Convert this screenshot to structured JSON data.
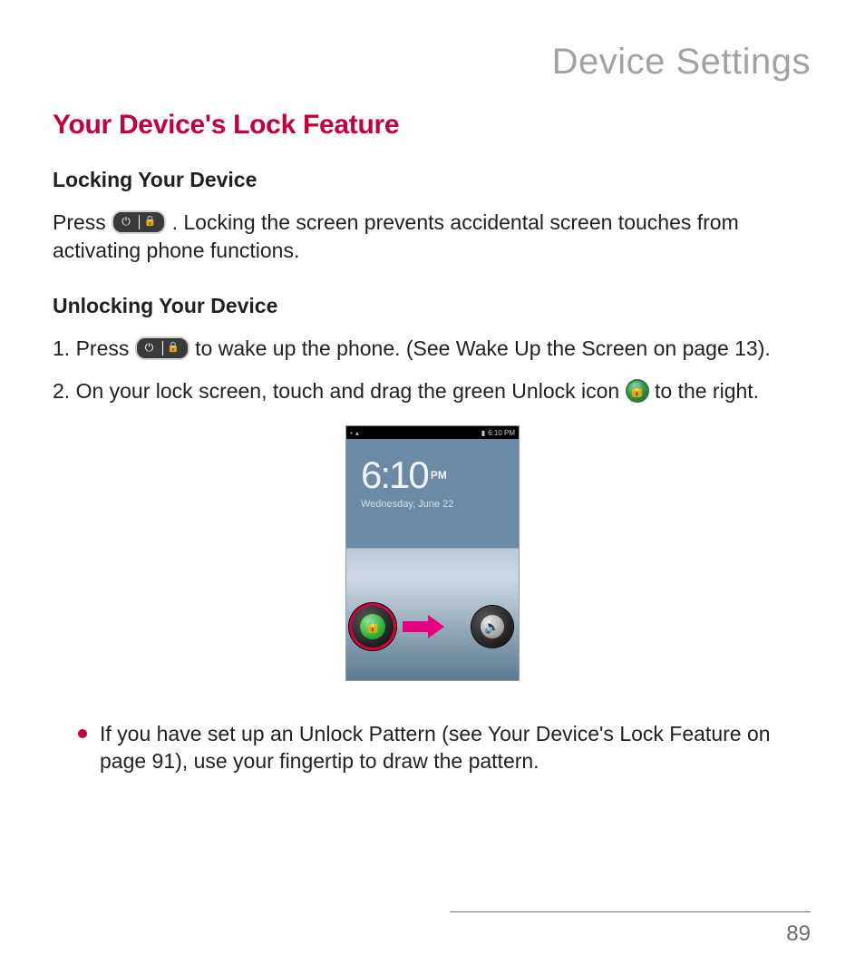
{
  "chapter_title": "Device Settings",
  "section_title": "Your Device's Lock Feature",
  "locking": {
    "heading": "Locking Your Device",
    "para_a": "Press ",
    "para_b": " . Locking the screen prevents accidental screen touches from activating phone functions."
  },
  "unlocking": {
    "heading": "Unlocking Your Device",
    "step1_a": "1. Press ",
    "step1_b": " to wake up the phone. (See Wake Up the Screen on page 13).",
    "step2_a": "2. On your lock screen, touch and drag the green Unlock icon ",
    "step2_b": " to the right."
  },
  "phone": {
    "status_time": "6:10 PM",
    "clock_time": "6:10",
    "clock_ampm": "PM",
    "clock_date": "Wednesday, June 22",
    "unlock_glyph": "🔓",
    "sound_glyph": "🔊"
  },
  "bullet": "If you have set up an Unlock Pattern (see Your Device's Lock Feature on page 91), use your fingertip to draw the pattern.",
  "page_number": "89"
}
